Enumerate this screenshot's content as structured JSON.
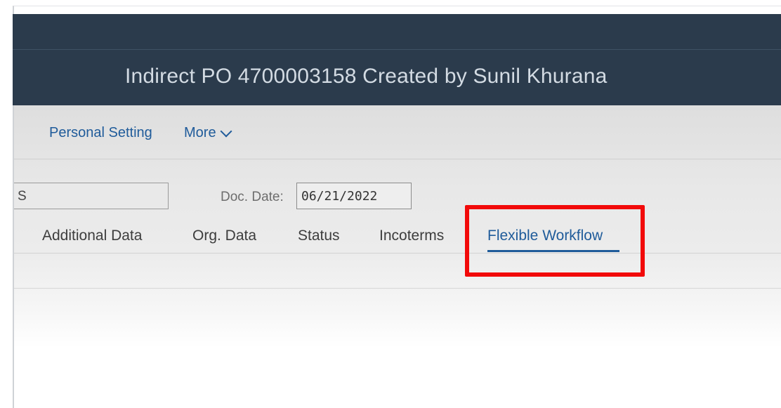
{
  "shell": {
    "title": "Indirect PO 4700003158 Created by Sunil Khurana"
  },
  "toolbar": {
    "personal_setting_label": "Personal Setting",
    "more_label": "More"
  },
  "header_fields": {
    "partial_field_value": "S",
    "doc_date_label": "Doc. Date:",
    "doc_date_value": "06/21/2022"
  },
  "tabs": [
    {
      "label": "Additional Data"
    },
    {
      "label": "Org. Data"
    },
    {
      "label": "Status"
    },
    {
      "label": "Incoterms"
    },
    {
      "label": "Flexible Workflow",
      "selected": true
    }
  ],
  "colors": {
    "shell_bg": "#2b3b4c",
    "link_blue": "#1f5b9a",
    "highlight_red": "#f20a0a"
  },
  "icons": {
    "more": "chevron-down-icon"
  }
}
